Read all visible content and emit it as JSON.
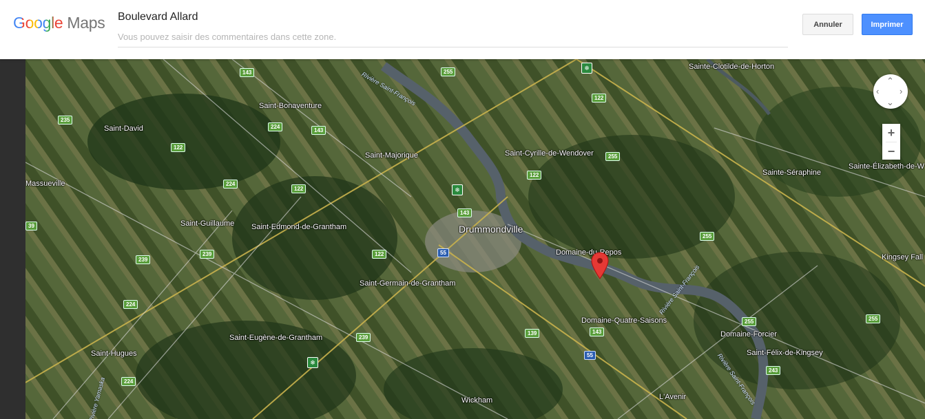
{
  "header": {
    "logo_google": "Google",
    "logo_maps": "Maps",
    "title": "Boulevard Allard",
    "comment_placeholder": "Vous pouvez saisir des commentaires dans cette zone.",
    "cancel_label": "Annuler",
    "print_label": "Imprimer"
  },
  "map": {
    "places": [
      "Sainte-Clotilde-de-Horton",
      "Saint-Bonaventure",
      "Saint-David",
      "Massueville",
      "Saint-Majorique",
      "Saint-Cyrille-de-Wendover",
      "Sainte-Séraphine",
      "Sainte-Élizabeth-de-W",
      "Saint-Guillaume",
      "Saint-Edmond-de-Grantham",
      "Drummondville",
      "Domaine-du-Repos",
      "Kingsey Fall",
      "Saint-Germain-de-Grantham",
      "Domaine-Quatre-Saisons",
      "Domaine-Forcier",
      "Saint-Eugène-de-Grantham",
      "Saint-Félix-de-Kingsey",
      "Saint-Hugues",
      "Wickham",
      "L'Avenir"
    ],
    "rivers": [
      "Rivière Saint-François",
      "Rivière Saint-François",
      "Rivière Saint-François",
      "Rivière Yamaska"
    ],
    "route_shields": [
      "143",
      "255",
      "122",
      "255",
      "235",
      "122",
      "224",
      "143",
      "224",
      "122",
      "122",
      "143",
      "39",
      "55",
      "122",
      "239",
      "239",
      "255",
      "224",
      "139",
      "143",
      "255",
      "255",
      "55",
      "239",
      "243",
      "224"
    ],
    "marker_icon": "map-pin-icon",
    "zoom_in": "+",
    "zoom_out": "−",
    "pan_icon": "pan-control-icon",
    "colors": {
      "marker": "#e53935",
      "print_button": "#4d90fe"
    }
  }
}
